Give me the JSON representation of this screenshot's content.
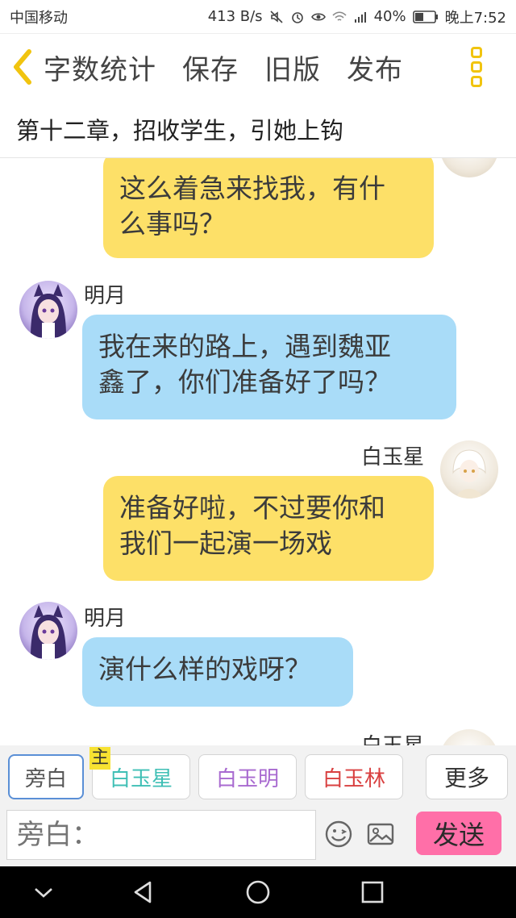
{
  "status_bar": {
    "carrier": "中国移动",
    "speed": "413 B/s",
    "battery": "40%",
    "time": "晚上7:52",
    "icons": [
      "mute-icon",
      "alarm-icon",
      "eye-icon",
      "wifi-icon",
      "signal-4g-icon",
      "battery-icon"
    ]
  },
  "toolbar": {
    "back_icon": "chevron-left-icon",
    "word_count": "字数统计",
    "save": "保存",
    "old_version": "旧版",
    "publish": "发布",
    "menu_icon": "more-vertical-icon",
    "accent": "#f1c40f"
  },
  "chapter_title": "第十二章，招收学生，引她上钩",
  "messages": [
    {
      "speaker": "",
      "side": "right",
      "color": "#fde068",
      "line1": "这么着急来找我，有什",
      "line2": "么事吗？"
    },
    {
      "speaker": "明月",
      "side": "left",
      "color": "#a9dcf8",
      "line1": "我在来的路上，遇到魏亚",
      "line2": "鑫了，你们准备好了吗？"
    },
    {
      "speaker": "白玉星",
      "side": "right",
      "color": "#fde068",
      "line1": "准备好啦，不过要你和",
      "line2": "我们一起演一场戏"
    },
    {
      "speaker": "明月",
      "side": "left",
      "color": "#a9dcf8",
      "line1": "演什么样的戏呀？",
      "line2": ""
    },
    {
      "speaker": "白玉星",
      "side": "right"
    }
  ],
  "characters": {
    "narration": "旁白",
    "lead_badge": "主",
    "c1": {
      "name": "白玉星",
      "color": "#3fbfb5"
    },
    "c2": {
      "name": "白玉明",
      "color": "#a86ad0"
    },
    "c3": {
      "name": "白玉林",
      "color": "#d94040"
    },
    "more": "更多"
  },
  "composer": {
    "placeholder": "旁白：",
    "emoji_icon": "emoji-icon",
    "image_icon": "image-icon",
    "send": "发送",
    "send_color": "#ff6fa8"
  },
  "navbar": {
    "icons": [
      "hide-keyboard-icon",
      "back-triangle-icon",
      "home-circle-icon",
      "recents-square-icon"
    ]
  }
}
